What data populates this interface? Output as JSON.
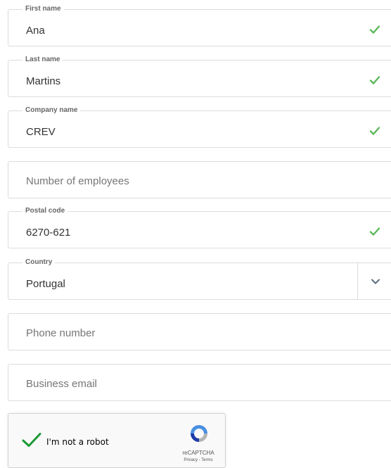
{
  "form": {
    "first_name": {
      "legend": "First name",
      "value": "Ana"
    },
    "last_name": {
      "legend": "Last name",
      "value": "Martins"
    },
    "company_name": {
      "legend": "Company name",
      "value": "CREV"
    },
    "employees": {
      "placeholder": "Number of employees"
    },
    "postal_code": {
      "legend": "Postal code",
      "value": "6270-621"
    },
    "country": {
      "legend": "Country",
      "value": "Portugal"
    },
    "phone": {
      "placeholder": "Phone number"
    },
    "email": {
      "placeholder": "Business email"
    }
  },
  "captcha": {
    "label": "I'm not a robot",
    "brand": "reCAPTCHA",
    "links": "Privacy - Terms"
  },
  "icons": {
    "valid": "checkmark-icon",
    "dropdown": "chevron-down-icon",
    "recaptcha": "recaptcha-logo-icon"
  },
  "colors": {
    "valid_check": "#5cb85c",
    "captcha_check": "#1a9a35",
    "field_border": "#dcdcdc",
    "recaptcha_blue": "#4a90e2",
    "recaptcha_gray": "#b4b4b4"
  }
}
